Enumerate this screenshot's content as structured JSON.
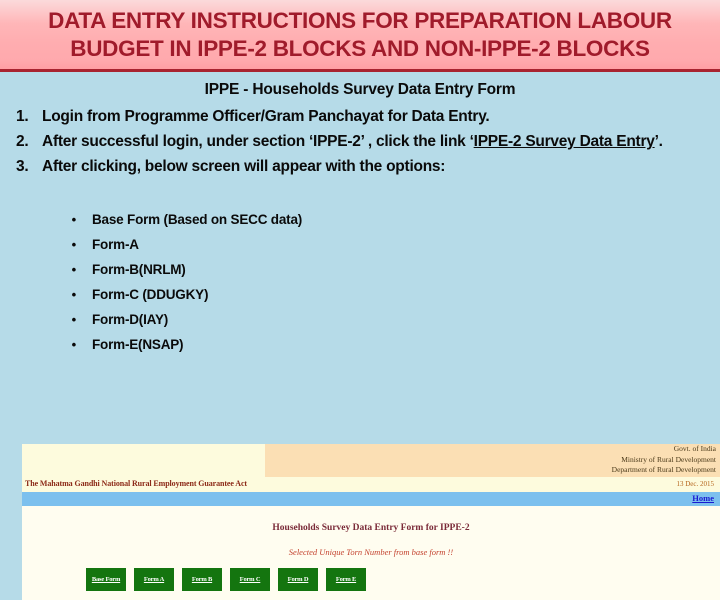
{
  "slide": {
    "title_lines": [
      "DATA ENTRY INSTRUCTIONS FOR PREPARATION  LABOUR",
      "BUDGET  IN IPPE-2 BLOCKS AND NON-IPPE-2 BLOCKS"
    ],
    "title_color": "#a01b2b",
    "banner_color": "#ffadb0",
    "body_background": "#b6dbe8",
    "subheading": "IPPE - Households Survey Data Entry Form"
  },
  "steps": [
    {
      "number": "1.",
      "text_parts": [
        {
          "text": "Login from Programme Officer/Gram Panchayat for Data Entry.",
          "underline": false
        }
      ]
    },
    {
      "number": "2.",
      "text_parts": [
        {
          "text": "After successful  login,  under section ‘IPPE-2’ , click the link ‘",
          "underline": false
        },
        {
          "text": "IPPE-2 Survey Data Entry",
          "underline": true
        },
        {
          "text": "’.",
          "underline": false
        }
      ]
    },
    {
      "number": "3.",
      "text_parts": [
        {
          "text": "After clicking, below screen will appear with the options:",
          "underline": false
        }
      ]
    }
  ],
  "bullets": [
    {
      "marker": "•",
      "label": "Base Form (Based on SECC data)"
    },
    {
      "marker": "•",
      "label": "Form-A"
    },
    {
      "marker": "•",
      "label": "Form-B(NRLM)"
    },
    {
      "marker": "•",
      "label": "Form-C (DDUGKY)"
    },
    {
      "marker": "•",
      "label": "Form-D(IAY)"
    },
    {
      "marker": "•",
      "label": "Form-E(NSAP)"
    }
  ],
  "screenshot": {
    "govt_lines": [
      "Govt. of India",
      "Ministry of Rural Development",
      "Department of Rural Development"
    ],
    "act_title": "The Mahatma Gandhi National Rural Employment Guarantee Act",
    "date": "13 Dec. 2015",
    "home_link": "Home",
    "page_title": "Households Survey Data Entry Form for IPPE-2",
    "page_note": "Selected Unique Torn Number from base form !!",
    "buttons": [
      "Base Form",
      "Form A",
      "Form B",
      "Form C",
      "Form D",
      "Form E"
    ],
    "button_color": "#14750f",
    "nav_color": "#7cc0ee"
  }
}
